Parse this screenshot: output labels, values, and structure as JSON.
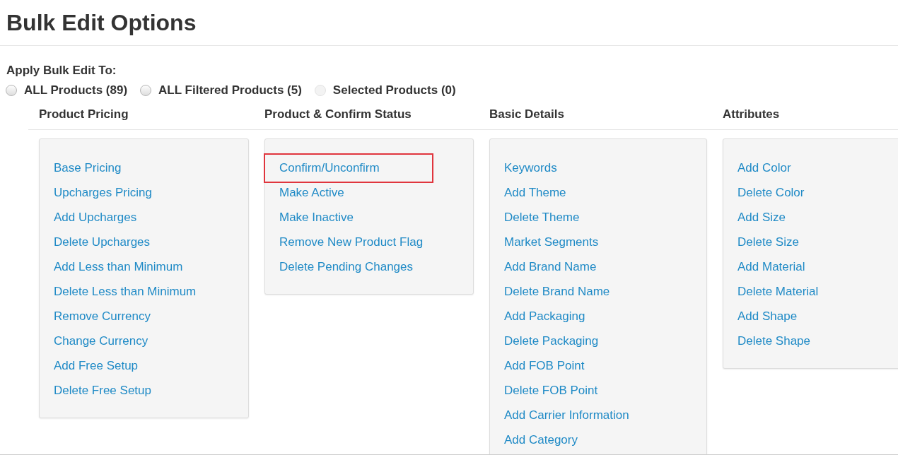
{
  "page": {
    "title": "Bulk Edit Options"
  },
  "apply_to": {
    "label": "Apply Bulk Edit To:",
    "options": [
      {
        "label": "ALL Products (89)",
        "selected": false,
        "disabled": false
      },
      {
        "label": "ALL Filtered Products (5)",
        "selected": false,
        "disabled": false
      },
      {
        "label": "Selected Products (0)",
        "selected": false,
        "disabled": true
      }
    ]
  },
  "sections": [
    {
      "title": "Product Pricing",
      "links": [
        {
          "label": "Base Pricing",
          "highlighted": false
        },
        {
          "label": "Upcharges Pricing",
          "highlighted": false
        },
        {
          "label": "Add Upcharges",
          "highlighted": false
        },
        {
          "label": "Delete Upcharges",
          "highlighted": false
        },
        {
          "label": "Add Less than Minimum",
          "highlighted": false
        },
        {
          "label": "Delete Less than Minimum",
          "highlighted": false
        },
        {
          "label": "Remove Currency",
          "highlighted": false
        },
        {
          "label": "Change Currency",
          "highlighted": false
        },
        {
          "label": "Add Free Setup",
          "highlighted": false
        },
        {
          "label": "Delete Free Setup",
          "highlighted": false
        }
      ]
    },
    {
      "title": "Product & Confirm Status",
      "links": [
        {
          "label": "Confirm/Unconfirm",
          "highlighted": true
        },
        {
          "label": "Make Active",
          "highlighted": false
        },
        {
          "label": "Make Inactive",
          "highlighted": false
        },
        {
          "label": "Remove New Product Flag",
          "highlighted": false
        },
        {
          "label": "Delete Pending Changes",
          "highlighted": false
        }
      ]
    },
    {
      "title": "Basic Details",
      "links": [
        {
          "label": "Keywords",
          "highlighted": false
        },
        {
          "label": "Add Theme",
          "highlighted": false
        },
        {
          "label": "Delete Theme",
          "highlighted": false
        },
        {
          "label": "Market Segments",
          "highlighted": false
        },
        {
          "label": "Add Brand Name",
          "highlighted": false
        },
        {
          "label": "Delete Brand Name",
          "highlighted": false
        },
        {
          "label": "Add Packaging",
          "highlighted": false
        },
        {
          "label": "Delete Packaging",
          "highlighted": false
        },
        {
          "label": "Add FOB Point",
          "highlighted": false
        },
        {
          "label": "Delete FOB Point",
          "highlighted": false
        },
        {
          "label": "Add Carrier Information",
          "highlighted": false
        },
        {
          "label": "Add Category",
          "highlighted": false
        }
      ]
    },
    {
      "title": "Attributes",
      "links": [
        {
          "label": "Add Color",
          "highlighted": false
        },
        {
          "label": "Delete Color",
          "highlighted": false
        },
        {
          "label": "Add Size",
          "highlighted": false
        },
        {
          "label": "Delete Size",
          "highlighted": false
        },
        {
          "label": "Add Material",
          "highlighted": false
        },
        {
          "label": "Delete Material",
          "highlighted": false
        },
        {
          "label": "Add Shape",
          "highlighted": false
        },
        {
          "label": "Delete Shape",
          "highlighted": false
        }
      ]
    }
  ]
}
